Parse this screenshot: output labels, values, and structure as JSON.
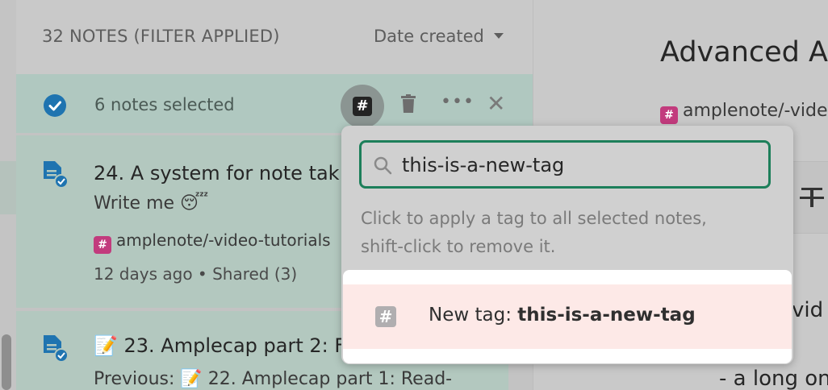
{
  "list": {
    "count_label": "32 NOTES (FILTER APPLIED)",
    "sort_label": "Date created"
  },
  "selection": {
    "count_label": "6 notes selected",
    "tag_icon": "hash-icon",
    "delete_icon": "trash-icon",
    "more_icon": "more-icon",
    "close_icon": "close-icon"
  },
  "notes": [
    {
      "title": "24. A system for note tak",
      "body": "Write me 😴",
      "tag": "amplenote/-video-tutorials",
      "meta": "12 days ago • Shared (3)"
    },
    {
      "title": "📝 23. Amplecap part 2: F",
      "body": "Previous: 📝 22. Amplecap part 1: Read-"
    }
  ],
  "editor": {
    "title": "Advanced A",
    "tag": "amplenote/-vide",
    "text1": "vid",
    "text2": "- a long on"
  },
  "tag_popup": {
    "search_value": "this-is-a-new-tag",
    "hint_line1": "Click to apply a tag to all selected notes,",
    "hint_line2": "shift-click to remove it.",
    "result_prefix": "New tag: ",
    "result_name": "this-is-a-new-tag"
  },
  "colors": {
    "accent": "#1d7f5a",
    "check_blue": "#1f74b0",
    "tag_pink": "#c23b7d",
    "highlight": "#fde9e7"
  }
}
